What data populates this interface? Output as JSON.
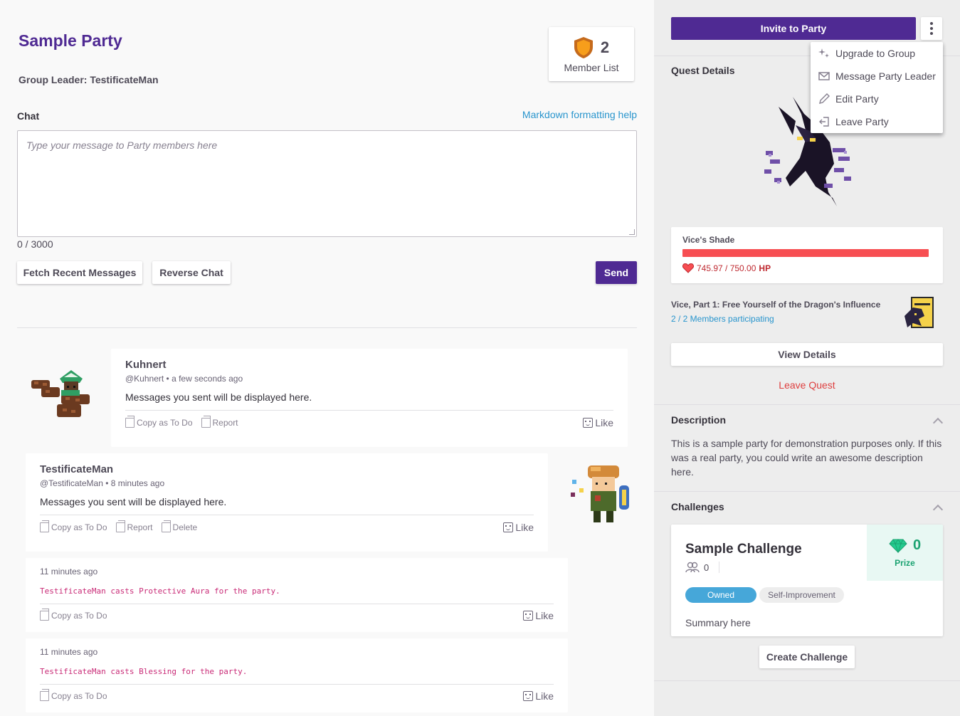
{
  "party": {
    "title": "Sample Party",
    "group_leader": "Group Leader: TestificateMan",
    "member_count": "2",
    "member_list_label": "Member List"
  },
  "chat": {
    "label": "Chat",
    "markdown_help": "Markdown formatting help",
    "placeholder": "Type your message to Party members here",
    "char_count": "0 / 3000",
    "fetch_button": "Fetch Recent Messages",
    "reverse_button": "Reverse Chat",
    "send_button": "Send"
  },
  "messages": [
    {
      "name": "Kuhnert",
      "meta": "@Kuhnert • a few seconds ago",
      "text": "Messages you sent will be displayed here.",
      "copy": "Copy as To Do",
      "report": "Report",
      "like": "Like"
    },
    {
      "name": "TestificateMan",
      "meta": "@TestificateMan • 8 minutes ago",
      "text": "Messages you sent will be displayed here.",
      "copy": "Copy as To Do",
      "report": "Report",
      "delete": "Delete",
      "like": "Like"
    }
  ],
  "system_messages": [
    {
      "time": "11 minutes ago",
      "text": "TestificateMan casts Protective Aura for the party.",
      "copy": "Copy as To Do",
      "like": "Like"
    },
    {
      "time": "11 minutes ago",
      "text": "TestificateMan casts Blessing for the party.",
      "copy": "Copy as To Do",
      "like": "Like"
    }
  ],
  "sidebar": {
    "invite_button": "Invite to Party",
    "menu": {
      "upgrade": "Upgrade to Group",
      "message_leader": "Message Party Leader",
      "edit": "Edit Party",
      "leave": "Leave Party"
    },
    "quest_heading": "Quest Details",
    "boss": {
      "name": "Vice's Shade",
      "hp_current": 745.97,
      "hp_max": 750.0,
      "hp_text": "745.97 / 750.00",
      "hp_unit": "HP"
    },
    "quest_title": "Vice, Part 1: Free Yourself of the Dragon's Influence",
    "participants": "2 / 2 Members participating",
    "view_details": "View Details",
    "leave_quest": "Leave Quest",
    "description_heading": "Description",
    "description_text": "This is a sample party for demonstration purposes only. If this was a real party, you could write an awesome description here.",
    "challenges_heading": "Challenges",
    "challenge": {
      "title": "Sample Challenge",
      "members": "0",
      "prize": "0",
      "prize_label": "Prize",
      "tag_owned": "Owned",
      "tag_category": "Self-Improvement",
      "summary": "Summary here"
    },
    "create_challenge": "Create Challenge"
  },
  "colors": {
    "brand_purple": "#4f2a93",
    "link_blue": "#2995cd",
    "hp_red": "#f74e52",
    "danger_red": "#de3f3f",
    "gem_green": "#1ca372",
    "system_text": "#c92b77"
  }
}
